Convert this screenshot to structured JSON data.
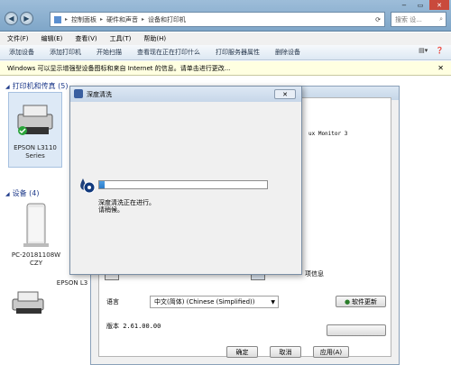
{
  "nav": {
    "back_icon": "back-arrow-icon",
    "forward_icon": "forward-arrow-icon"
  },
  "address": {
    "crumbs": [
      "控制面板",
      "硬件和声音",
      "设备和打印机"
    ]
  },
  "search": {
    "placeholder": "搜索 设..."
  },
  "menu": [
    "文件(F)",
    "编辑(E)",
    "查看(V)",
    "工具(T)",
    "帮助(H)"
  ],
  "toolbar": [
    "添加设备",
    "添加打印机",
    "开始扫描",
    "查看现在正在打印什么",
    "打印服务器属性",
    "删除设备"
  ],
  "infobar": {
    "text": "Windows 可以显示增强型设备图标和来自 Internet 的信息。请单击进行更改..."
  },
  "groups": {
    "printers": "打印机和传真 (5)",
    "devices": "设备 (4)"
  },
  "devices": {
    "printer1": {
      "label1": "EPSON L3110",
      "label2": "Series"
    },
    "pc": {
      "label1": "PC-20181108W",
      "label2": "CZY"
    },
    "printer2": {
      "label": "EPSON L3"
    }
  },
  "props": {
    "monitor_text": "ux Monitor 3",
    "lang_label": "语言",
    "lang_value": "中文(简体) (Chinese (Simplified))",
    "update_btn": "软件更新",
    "version": "版本 2.61.00.00",
    "info_text": "项信息",
    "ok": "确定",
    "cancel": "取消",
    "apply": "应用(A)"
  },
  "dialog": {
    "title": "深度清洗",
    "progress": 0.03,
    "msg1": "深度清洗正在进行。",
    "msg2": "请稍候。"
  }
}
